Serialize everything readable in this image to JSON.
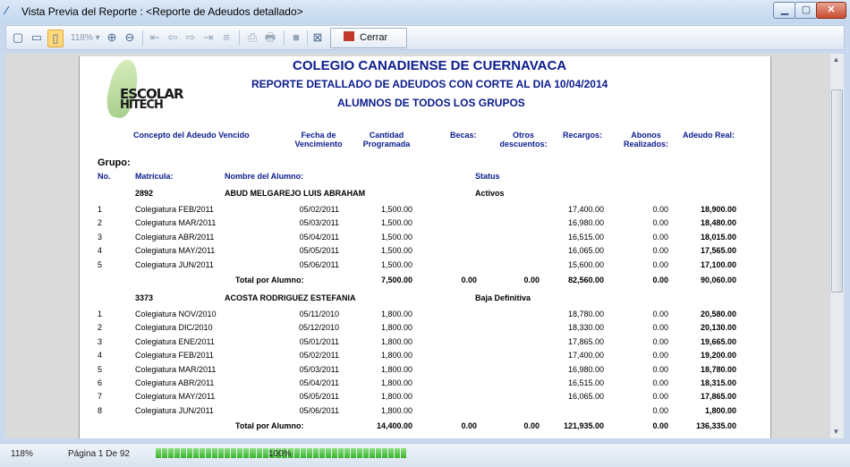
{
  "window": {
    "title": "Vista Previa del Reporte : <Reporte de Adeudos detallado>"
  },
  "toolbar": {
    "zoom": "118%",
    "close_label": "Cerrar"
  },
  "report": {
    "school": "COLEGIO CANADIENSE DE CUERNAVACA",
    "subtitle": "REPORTE DETALLADO DE ADEUDOS CON CORTE AL DIA 10/04/2014",
    "subtitle2": "ALUMNOS DE TODOS LOS GRUPOS",
    "logo_text_1": "ESCOLAR",
    "logo_text_2": "HITECH",
    "headers": {
      "concepto": "Concepto del Adeudo Vencido",
      "fecha": "Fecha de\nVencimiento",
      "cantidad": "Cantidad\nProgramada",
      "becas": "Becas:",
      "otros": "Otros\ndescuentos:",
      "recargos": "Recargos:",
      "abonos": "Abonos\nRealizados:",
      "adeudo": "Adeudo Real:"
    },
    "grupo_label": "Grupo:",
    "no_label": "No.",
    "matricula_label": "Matrícula:",
    "nombre_label": "Nombre del Alumno:",
    "status_label": "Status",
    "total_label": "Total por Alumno:",
    "students": [
      {
        "matricula": "2892",
        "nombre": "ABUD MELGAREJO LUIS ABRAHAM",
        "status": "Activos",
        "rows": [
          {
            "no": "1",
            "concepto": "Colegiatura FEB/2011",
            "fecha": "05/02/2011",
            "cantidad": "1,500.00",
            "recargos": "17,400.00",
            "abonos": "0.00",
            "adeudo": "18,900.00"
          },
          {
            "no": "2",
            "concepto": "Colegiatura MAR/2011",
            "fecha": "05/03/2011",
            "cantidad": "1,500.00",
            "recargos": "16,980.00",
            "abonos": "0.00",
            "adeudo": "18,480.00"
          },
          {
            "no": "3",
            "concepto": "Colegiatura ABR/2011",
            "fecha": "05/04/2011",
            "cantidad": "1,500.00",
            "recargos": "16,515.00",
            "abonos": "0.00",
            "adeudo": "18,015.00"
          },
          {
            "no": "4",
            "concepto": "Colegiatura MAY/2011",
            "fecha": "05/05/2011",
            "cantidad": "1,500.00",
            "recargos": "16,065.00",
            "abonos": "0.00",
            "adeudo": "17,565.00"
          },
          {
            "no": "5",
            "concepto": "Colegiatura JUN/2011",
            "fecha": "05/06/2011",
            "cantidad": "1,500.00",
            "recargos": "15,600.00",
            "abonos": "0.00",
            "adeudo": "17,100.00"
          }
        ],
        "total": {
          "cantidad": "7,500.00",
          "becas": "0.00",
          "otros": "0.00",
          "recargos": "82,560.00",
          "abonos": "0.00",
          "adeudo": "90,060.00"
        }
      },
      {
        "matricula": "3373",
        "nombre": "ACOSTA RODRIGUEZ ESTEFANIA",
        "status": "Baja Definitiva",
        "rows": [
          {
            "no": "1",
            "concepto": "Colegiatura NOV/2010",
            "fecha": "05/11/2010",
            "cantidad": "1,800.00",
            "recargos": "18,780.00",
            "abonos": "0.00",
            "adeudo": "20,580.00"
          },
          {
            "no": "2",
            "concepto": "Colegiatura DIC/2010",
            "fecha": "05/12/2010",
            "cantidad": "1,800.00",
            "recargos": "18,330.00",
            "abonos": "0.00",
            "adeudo": "20,130.00"
          },
          {
            "no": "3",
            "concepto": "Colegiatura ENE/2011",
            "fecha": "05/01/2011",
            "cantidad": "1,800.00",
            "recargos": "17,865.00",
            "abonos": "0.00",
            "adeudo": "19,665.00"
          },
          {
            "no": "4",
            "concepto": "Colegiatura FEB/2011",
            "fecha": "05/02/2011",
            "cantidad": "1,800.00",
            "recargos": "17,400.00",
            "abonos": "0.00",
            "adeudo": "19,200.00"
          },
          {
            "no": "5",
            "concepto": "Colegiatura MAR/2011",
            "fecha": "05/03/2011",
            "cantidad": "1,800.00",
            "recargos": "16,980.00",
            "abonos": "0.00",
            "adeudo": "18,780.00"
          },
          {
            "no": "6",
            "concepto": "Colegiatura ABR/2011",
            "fecha": "05/04/2011",
            "cantidad": "1,800.00",
            "recargos": "16,515.00",
            "abonos": "0.00",
            "adeudo": "18,315.00"
          },
          {
            "no": "7",
            "concepto": "Colegiatura MAY/2011",
            "fecha": "05/05/2011",
            "cantidad": "1,800.00",
            "recargos": "16,065.00",
            "abonos": "0.00",
            "adeudo": "17,865.00"
          },
          {
            "no": "8",
            "concepto": "Colegiatura JUN/2011",
            "fecha": "05/06/2011",
            "cantidad": "1,800.00",
            "recargos": "",
            "abonos": "0.00",
            "adeudo": "1,800.00"
          }
        ],
        "total": {
          "cantidad": "14,400.00",
          "becas": "0.00",
          "otros": "0.00",
          "recargos": "121,935.00",
          "abonos": "0.00",
          "adeudo": "136,335.00"
        }
      }
    ]
  },
  "status": {
    "zoom": "118%",
    "page": "Página 1 De 92",
    "progress": 100,
    "progress_label": "100%"
  }
}
